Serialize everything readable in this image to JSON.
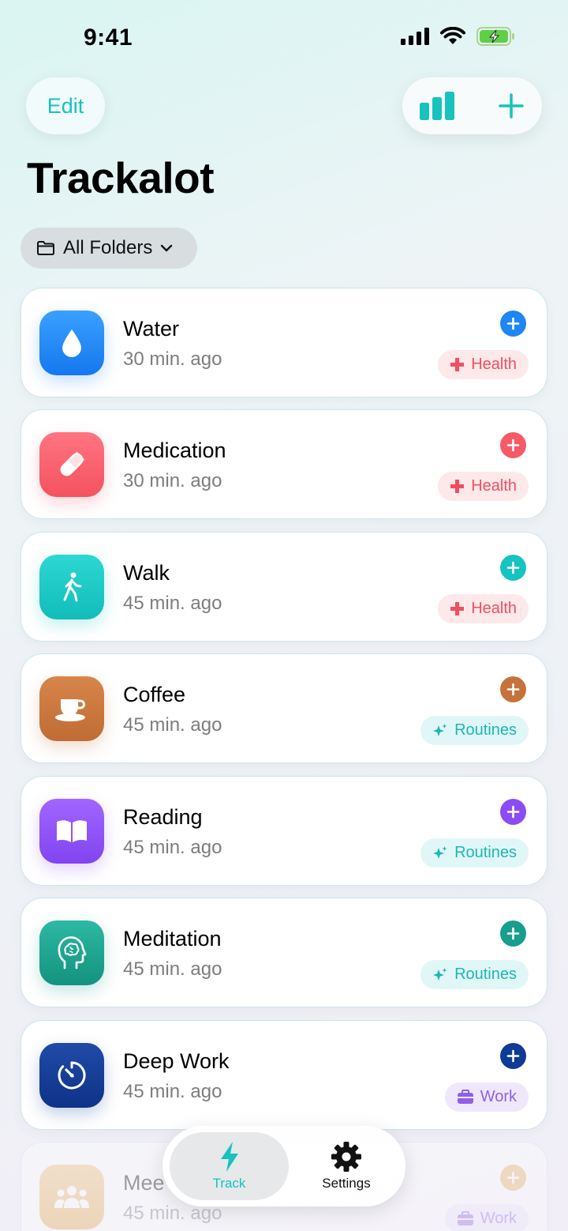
{
  "status_bar": {
    "time": "9:41"
  },
  "header": {
    "edit_label": "Edit",
    "title": "Trackalot",
    "folder_label": "All Folders",
    "accent": "#17c3bd"
  },
  "trackers": [
    {
      "name": "Water",
      "time": "30 min. ago",
      "tag": "Health",
      "tag_kind": "health",
      "icon": "water-drop-icon",
      "color": "#1f86f5"
    },
    {
      "name": "Medication",
      "time": "30 min. ago",
      "tag": "Health",
      "tag_kind": "health",
      "icon": "pill-icon",
      "color": "#f65a67"
    },
    {
      "name": "Walk",
      "time": "45 min. ago",
      "tag": "Health",
      "tag_kind": "health",
      "icon": "walking-person-icon",
      "color": "#16c3c0"
    },
    {
      "name": "Coffee",
      "time": "45 min. ago",
      "tag": "Routines",
      "tag_kind": "routines",
      "icon": "coffee-cup-icon",
      "color": "#c6733b"
    },
    {
      "name": "Reading",
      "time": "45 min. ago",
      "tag": "Routines",
      "tag_kind": "routines",
      "icon": "book-icon",
      "color": "#8b4cf6"
    },
    {
      "name": "Meditation",
      "time": "45 min. ago",
      "tag": "Routines",
      "tag_kind": "routines",
      "icon": "brain-head-icon",
      "color": "#179e8c"
    },
    {
      "name": "Deep Work",
      "time": "45 min. ago",
      "tag": "Work",
      "tag_kind": "work",
      "icon": "timer-icon",
      "color": "#0f3a96"
    },
    {
      "name": "Mee",
      "time": "45 min. ago",
      "tag": "Work",
      "tag_kind": "work",
      "icon": "people-icon",
      "color": "#e8b25e"
    }
  ],
  "tab_bar": {
    "track_label": "Track",
    "settings_label": "Settings"
  }
}
